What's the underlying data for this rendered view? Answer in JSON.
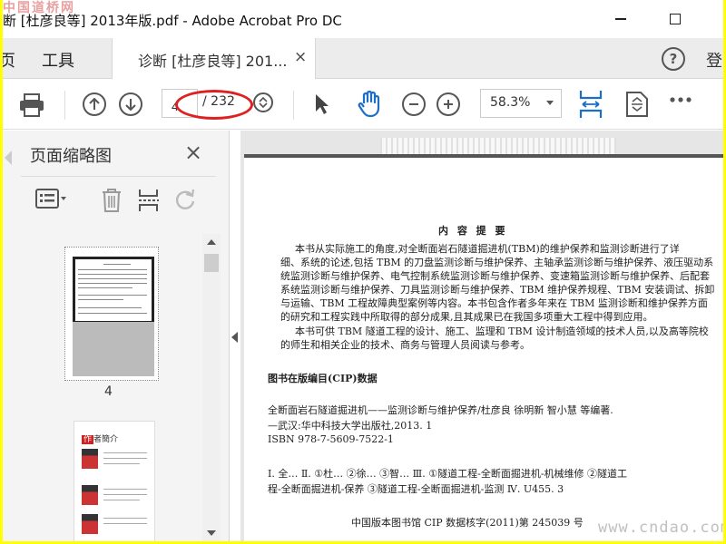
{
  "watermark_top": "中国道桥网",
  "window": {
    "title": "断 [杜彦良等] 2013年版.pdf - Adobe Acrobat Pro DC"
  },
  "tabs": {
    "home": "页",
    "tools": "工具",
    "document": "诊断 [杜彦良等] 201...",
    "close": "×",
    "help": "?",
    "login": "登"
  },
  "toolbar": {
    "page_current": "4",
    "page_total": "/ 232",
    "zoom": "58.3%",
    "icons": [
      "print-icon",
      "previous-page-icon",
      "next-page-icon",
      "page-stepper-icon",
      "select-arrow-icon",
      "hand-tool-icon",
      "zoom-out-icon",
      "zoom-in-icon",
      "fit-width-icon",
      "rotate-fit-icon",
      "more-icon"
    ],
    "highlight_color": "#e02020"
  },
  "left_panel": {
    "title": "页面缩略图",
    "close": "×",
    "thumbnails": [
      {
        "label": "4"
      },
      {
        "label": ""
      }
    ],
    "thumb2_header": "作者簡介",
    "thumb2_tag": "作"
  },
  "document": {
    "heading": "内 容 提 要",
    "paragraph1": [
      "本书从实际施工的角度,对全断面岩石隧道掘进机(TBM)的维护保养和监测诊断进行了详",
      "细、系统的论述,包括 TBM 的刀盘监测诊断与维护保养、主轴承监测诊断与维护保养、液压驱动系",
      "统监测诊断与维护保养、电气控制系统监测诊断与维护保养、变速箱监测诊断与维护保养、后配套",
      "系统监测诊断与维护保养、刀具监测诊断与维护保养、TBM 维护保养规程、TBM 安装调试、拆卸",
      "与运输、TBM 工程故障典型案例等内容。本书包含作者多年来在 TBM 监测诊断和维护保养方面",
      "的研究和工程实践中所取得的部分成果,且其成果已在我国多项重大工程中得到应用。"
    ],
    "paragraph2": [
      "本书可供 TBM 隧道工程的设计、施工、监理和 TBM 设计制造领域的技术人员,以及高等院校",
      "的师生和相关企业的技术、商务与管理人员阅读与参考。"
    ],
    "cip_heading": "图书在版编目(CIP)数据",
    "cip_lines": [
      "全断面岩石隧道掘进机——监测诊断与维护保养/杜彦良    徐明新    智小慧    等编著.",
      "—武汉:华中科技大学出版社,2013. 1",
      "ISBN 978-7-5609-7522-1"
    ],
    "class_lines": [
      "Ⅰ. 全…    Ⅱ. ①杜…    ②徐…    ③智…    Ⅲ. ①隧道工程-全断面掘进机-机械维修    ②隧道工",
      "程-全断面掘进机-保养    ③隧道工程-全断面掘进机-监测    Ⅳ. U455. 3"
    ],
    "cip_number": "中国版本图书馆 CIP 数据核字(2011)第 245039 号"
  },
  "watermark_bottom": "www.cndao.com"
}
